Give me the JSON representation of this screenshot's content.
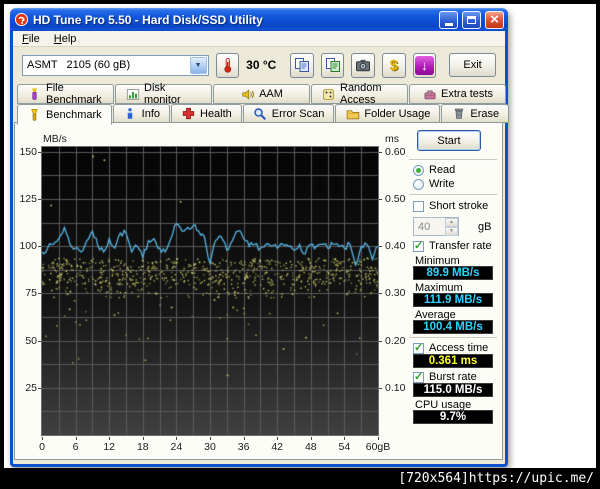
{
  "window": {
    "title": "HD Tune Pro 5.50 - Hard Disk/SSD Utility"
  },
  "menu": {
    "items": [
      "File",
      "Help"
    ]
  },
  "toolbar": {
    "drive_select": "ASMT   2105 (60 gB)",
    "temperature": "30 °C",
    "exit_label": "Exit",
    "icons": [
      "thermometer-icon",
      "copy-screenshot-icon",
      "copy-text-icon",
      "camera-icon",
      "dollar-icon",
      "update-icon"
    ]
  },
  "tabs": {
    "row1": [
      {
        "label": "File Benchmark",
        "icon": "purple-torch-icon"
      },
      {
        "label": "Disk monitor",
        "icon": "bar-chart-icon"
      },
      {
        "label": "AAM",
        "icon": "speaker-icon"
      },
      {
        "label": "Random Access",
        "icon": "dice-icon"
      },
      {
        "label": "Extra tests",
        "icon": "toolbox-icon"
      }
    ],
    "row2": [
      {
        "label": "Benchmark",
        "icon": "torch-icon",
        "active": true
      },
      {
        "label": "Info",
        "icon": "info-icon"
      },
      {
        "label": "Health",
        "icon": "health-cross-icon"
      },
      {
        "label": "Error Scan",
        "icon": "magnifier-icon"
      },
      {
        "label": "Folder Usage",
        "icon": "folder-icon"
      },
      {
        "label": "Erase",
        "icon": "trash-icon"
      }
    ]
  },
  "sidebar": {
    "start_label": "Start",
    "read_label": "Read",
    "read_selected": true,
    "write_label": "Write",
    "write_selected": false,
    "short_stroke_label": "Short stroke",
    "short_stroke_checked": false,
    "capacity_value": "40",
    "capacity_unit": "gB",
    "transfer_rate_label": "Transfer rate",
    "transfer_rate_checked": true,
    "minimum_label": "Minimum",
    "minimum_value": "89.9 MB/s",
    "maximum_label": "Maximum",
    "maximum_value": "111.9 MB/s",
    "average_label": "Average",
    "average_value": "100.4 MB/s",
    "access_time_label": "Access time",
    "access_time_checked": true,
    "access_time_value": "0.361 ms",
    "burst_rate_label": "Burst rate",
    "burst_rate_checked": true,
    "burst_rate_value": "115.0 MB/s",
    "cpu_usage_label": "CPU usage",
    "cpu_usage_value": "9.7%"
  },
  "colors": {
    "value_cyan": "#2bd5ff",
    "value_yellow": "#ffff2e",
    "value_white": "#ffffff",
    "line_blue": "#55b6e6",
    "scatter_yellow": "#d6d66e",
    "titlebar_blue": "#1258dd",
    "close_red": "#e1563a"
  },
  "chart_data": {
    "type": "line+scatter",
    "title": "",
    "x_axis": {
      "unit": "gB",
      "min": 0,
      "max": 60,
      "tick_step": 6,
      "grid_step": 3,
      "tick_labels": [
        "0",
        "6",
        "12",
        "18",
        "24",
        "30",
        "36",
        "42",
        "48",
        "54",
        "60gB"
      ]
    },
    "y_left_axis": {
      "unit": "MB/s",
      "min": 0,
      "max": 152.6,
      "grid_step": 12.5,
      "tick_values": [
        150,
        125,
        100,
        75,
        50,
        25
      ]
    },
    "y_right_axis": {
      "unit": "ms",
      "min": 0,
      "max": 0.6104,
      "tick_labels": [
        "0.60",
        "0.50",
        "0.40",
        "0.30",
        "0.20",
        "0.10"
      ]
    },
    "series": [
      {
        "name": "Transfer rate",
        "type": "line",
        "unit": "MB/s",
        "x_step_gb": 1,
        "stats": {
          "min": 89.9,
          "max": 111.9,
          "avg": 100.4
        },
        "jitter": 1.7,
        "seed": 7,
        "values": [
          97,
          99,
          101,
          104,
          110,
          101,
          99,
          97,
          103,
          108,
          100,
          97,
          104,
          99,
          107,
          107,
          97,
          100,
          94,
          103,
          104,
          99,
          97,
          104,
          112,
          108,
          110,
          111,
          108,
          105,
          91,
          103,
          105,
          98,
          103,
          108,
          104,
          100,
          101,
          99,
          101,
          100,
          99,
          101,
          100,
          98,
          101,
          96,
          101,
          100,
          101,
          99,
          101,
          100,
          99,
          101,
          90,
          100,
          101,
          93,
          100
        ]
      },
      {
        "name": "Access time",
        "type": "scatter",
        "unit": "ms",
        "avg_ms": 0.361,
        "count": 820,
        "seed": 42,
        "sparse_after_x": 36,
        "bands": [
          {
            "p": 0.74,
            "lo": 80,
            "hi": 94
          },
          {
            "p": 0.91,
            "lo": 73,
            "hi": 81
          },
          {
            "p": 0.985,
            "lo": 58,
            "hi": 76
          },
          {
            "p": 1.0,
            "lo": 38,
            "hi": 58
          }
        ],
        "outliers": [
          [
            1.5,
            122
          ],
          [
            9,
            148
          ],
          [
            11,
            146
          ],
          [
            24.6,
            124
          ],
          [
            4.8,
            67
          ],
          [
            12.8,
            64
          ],
          [
            23,
            68
          ],
          [
            34,
            68
          ],
          [
            43,
            46
          ],
          [
            44.6,
            75
          ],
          [
            33,
            32
          ],
          [
            47,
            52
          ]
        ]
      }
    ]
  },
  "watermark": "[720x564]https://upic.me/"
}
